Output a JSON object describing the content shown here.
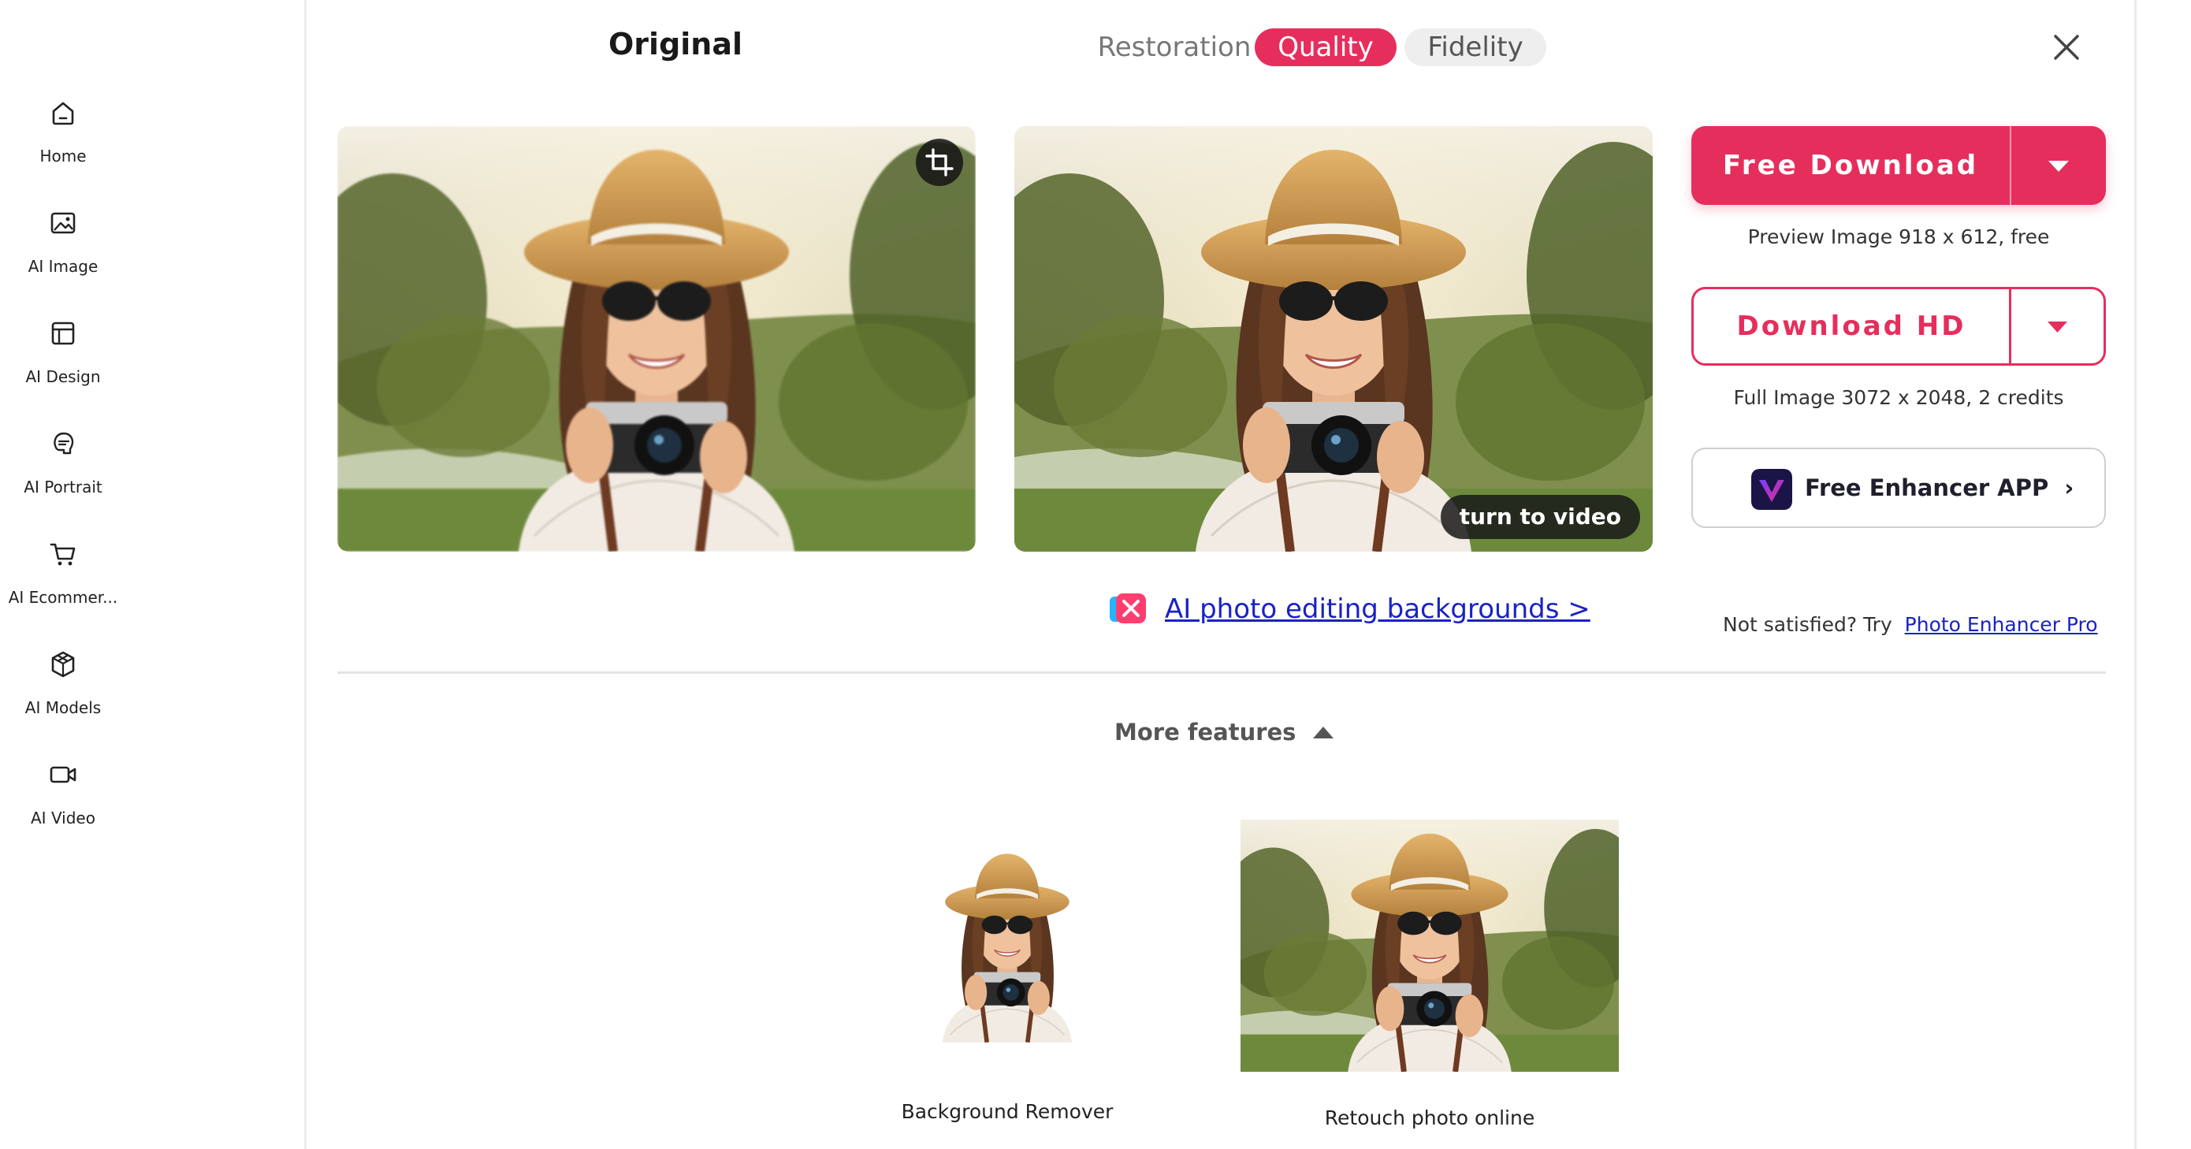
{
  "sidebar": {
    "items": [
      {
        "label": "Home",
        "icon": "home-icon"
      },
      {
        "label": "AI Image",
        "icon": "image-icon"
      },
      {
        "label": "AI Design",
        "icon": "layout-icon"
      },
      {
        "label": "AI Portrait",
        "icon": "portrait-icon"
      },
      {
        "label": "AI Ecommer...",
        "icon": "cart-icon"
      },
      {
        "label": "AI Models",
        "icon": "cube-icon"
      },
      {
        "label": "AI Video",
        "icon": "video-icon"
      }
    ]
  },
  "header": {
    "original_title": "Original",
    "tabs": [
      {
        "label": "Restoration",
        "active": false
      },
      {
        "label": "Quality",
        "active": true
      },
      {
        "label": "Fidelity",
        "active": false
      }
    ],
    "close_icon": "close-icon"
  },
  "images": {
    "crop_icon": "crop-icon",
    "turn_to_video": "turn to video"
  },
  "download": {
    "free_label": "Free Download",
    "preview_note": "Preview Image 918 x 612, free",
    "hd_label": "Download HD",
    "full_note": "Full Image 3072 x 2048, 2 credits",
    "app_label": "Free Enhancer APP",
    "app_chevron": "›"
  },
  "links": {
    "backgrounds": "AI photo editing backgrounds >",
    "not_satisfied": "Not satisfied? Try",
    "pro": "Photo Enhancer Pro"
  },
  "more_features": {
    "label": "More features",
    "cards": [
      {
        "label": "Background Remover"
      },
      {
        "label": "Retouch photo online"
      }
    ]
  },
  "colors": {
    "accent": "#e62e5c",
    "link": "#1a22c4"
  }
}
